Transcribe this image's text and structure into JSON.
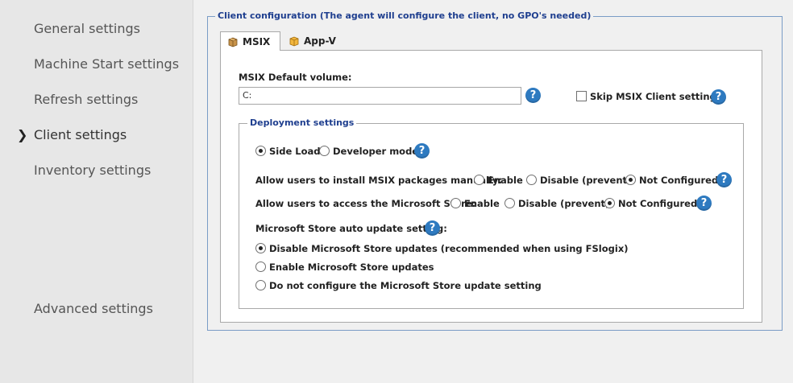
{
  "sidebar": {
    "items": [
      {
        "label": "General settings"
      },
      {
        "label": "Machine Start settings"
      },
      {
        "label": "Refresh settings"
      },
      {
        "label": "Client settings",
        "selected": true
      },
      {
        "label": "Inventory settings"
      },
      {
        "label": "Advanced settings"
      }
    ],
    "selected_marker": "❯"
  },
  "client_config": {
    "legend": "Client configuration (The agent will configure the client, no GPO's needed)",
    "tabs": [
      {
        "label": "MSIX",
        "icon": "package-icon",
        "active": true
      },
      {
        "label": "App-V",
        "icon": "appv-package-icon",
        "active": false
      }
    ],
    "msix": {
      "default_volume_label": "MSIX Default volume:",
      "default_volume_value": "C:",
      "skip_client_label": "Skip MSIX Client settings",
      "skip_client_checked": false,
      "deployment": {
        "legend": "Deployment settings",
        "mode_options": [
          {
            "label": "Side Load",
            "selected": true
          },
          {
            "label": "Developer mode",
            "selected": false
          }
        ],
        "install_manually": {
          "label": "Allow users to install MSIX packages manually:",
          "options": [
            {
              "label": "Enable",
              "selected": false
            },
            {
              "label": "Disable (prevent)",
              "selected": false
            },
            {
              "label": "Not Configured",
              "selected": true
            }
          ]
        },
        "store_access": {
          "label": "Allow users to access the Microsoft Store:",
          "options": [
            {
              "label": "Enable",
              "selected": false
            },
            {
              "label": "Disable (prevent)",
              "selected": false
            },
            {
              "label": "Not Configured",
              "selected": true
            }
          ]
        },
        "auto_update": {
          "label": "Microsoft Store auto update setting:",
          "options": [
            {
              "label": "Disable Microsoft Store updates (recommended when using FSlogix)",
              "selected": true
            },
            {
              "label": "Enable Microsoft Store updates",
              "selected": false
            },
            {
              "label": "Do not configure the Microsoft Store update setting",
              "selected": false
            }
          ]
        }
      }
    },
    "help_glyph": "?"
  },
  "colors": {
    "accent": "#2e7ac0",
    "legend_text": "#1f3f8f",
    "group_border": "#7a9cc6",
    "sidebar_bg": "#e7e7e7"
  }
}
